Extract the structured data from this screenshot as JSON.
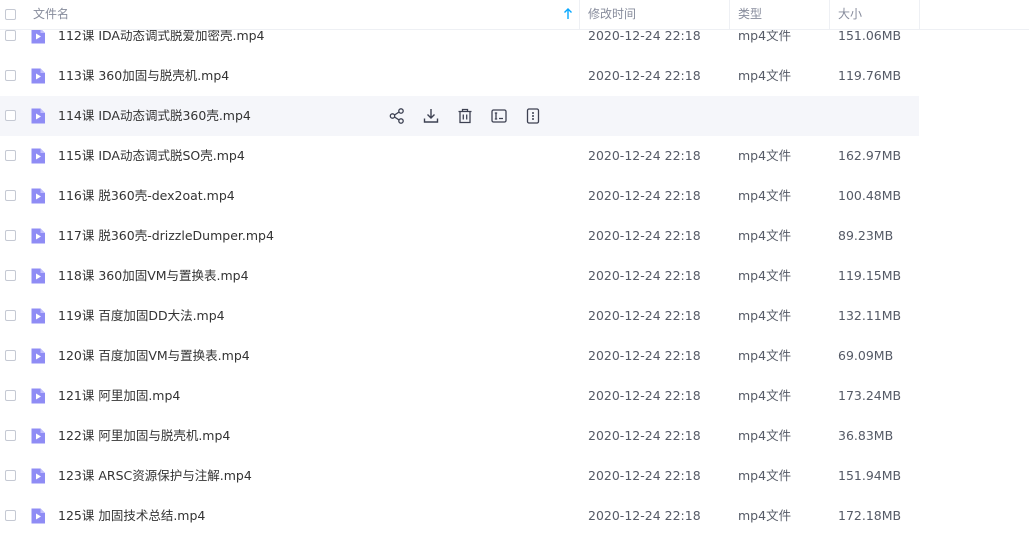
{
  "header": {
    "name_label": "文件名",
    "modified_label": "修改时间",
    "type_label": "类型",
    "size_label": "大小"
  },
  "colors": {
    "accent": "#06a7ff",
    "file_icon": "#8f8cf5",
    "hover_row": "#f5f6fa"
  },
  "files": [
    {
      "name": "112课 IDA动态调式脱爱加密壳.mp4",
      "modified": "2020-12-24 22:18",
      "type": "mp4文件",
      "size": "151.06MB"
    },
    {
      "name": "113课 360加固与脱壳机.mp4",
      "modified": "2020-12-24 22:18",
      "type": "mp4文件",
      "size": "119.76MB"
    },
    {
      "name": "114课 IDA动态调式脱360壳.mp4",
      "modified": "",
      "type": "",
      "size": "",
      "hovered": true
    },
    {
      "name": "115课 IDA动态调式脱SO壳.mp4",
      "modified": "2020-12-24 22:18",
      "type": "mp4文件",
      "size": "162.97MB"
    },
    {
      "name": "116课 脱360壳-dex2oat.mp4",
      "modified": "2020-12-24 22:18",
      "type": "mp4文件",
      "size": "100.48MB"
    },
    {
      "name": "117课 脱360壳-drizzleDumper.mp4",
      "modified": "2020-12-24 22:18",
      "type": "mp4文件",
      "size": "89.23MB"
    },
    {
      "name": "118课 360加固VM与置换表.mp4",
      "modified": "2020-12-24 22:18",
      "type": "mp4文件",
      "size": "119.15MB"
    },
    {
      "name": "119课 百度加固DD大法.mp4",
      "modified": "2020-12-24 22:18",
      "type": "mp4文件",
      "size": "132.11MB"
    },
    {
      "name": "120课 百度加固VM与置换表.mp4",
      "modified": "2020-12-24 22:18",
      "type": "mp4文件",
      "size": "69.09MB"
    },
    {
      "name": "121课 阿里加固.mp4",
      "modified": "2020-12-24 22:18",
      "type": "mp4文件",
      "size": "173.24MB"
    },
    {
      "name": "122课 阿里加固与脱壳机.mp4",
      "modified": "2020-12-24 22:18",
      "type": "mp4文件",
      "size": "36.83MB"
    },
    {
      "name": "123课 ARSC资源保护与注解.mp4",
      "modified": "2020-12-24 22:18",
      "type": "mp4文件",
      "size": "151.94MB"
    },
    {
      "name": "125课 加固技术总结.mp4",
      "modified": "2020-12-24 22:18",
      "type": "mp4文件",
      "size": "172.18MB"
    }
  ],
  "row_actions": [
    "share-icon",
    "download-icon",
    "delete-icon",
    "rename-icon",
    "more-icon"
  ]
}
